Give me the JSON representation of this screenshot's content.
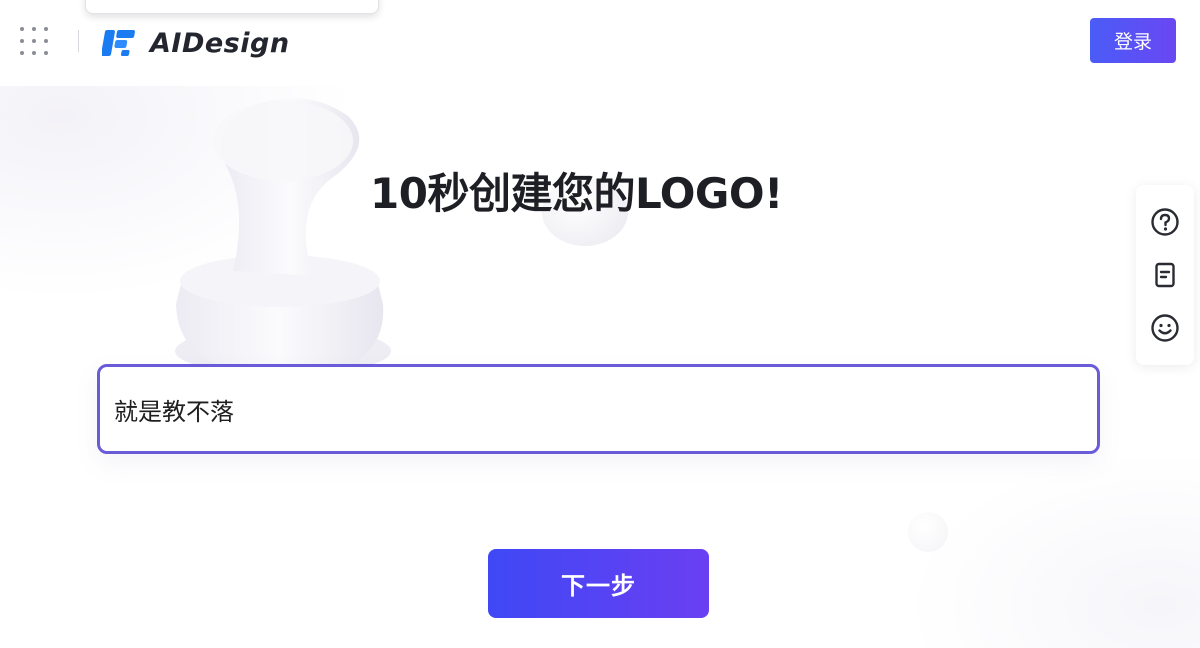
{
  "header": {
    "brand": "AIDesign",
    "login_label": "登录"
  },
  "main": {
    "title": "10秒创建您的LOGO!",
    "input_value": "就是教不落",
    "next_label": "下一步"
  },
  "side_tools": [
    {
      "icon": "help-circle-icon"
    },
    {
      "icon": "clipboard-icon"
    },
    {
      "icon": "smiley-icon"
    }
  ],
  "colors": {
    "accent": "#5a4ef5",
    "input_border": "#6a5cd8",
    "logo_blue": "#1b7cf2"
  }
}
